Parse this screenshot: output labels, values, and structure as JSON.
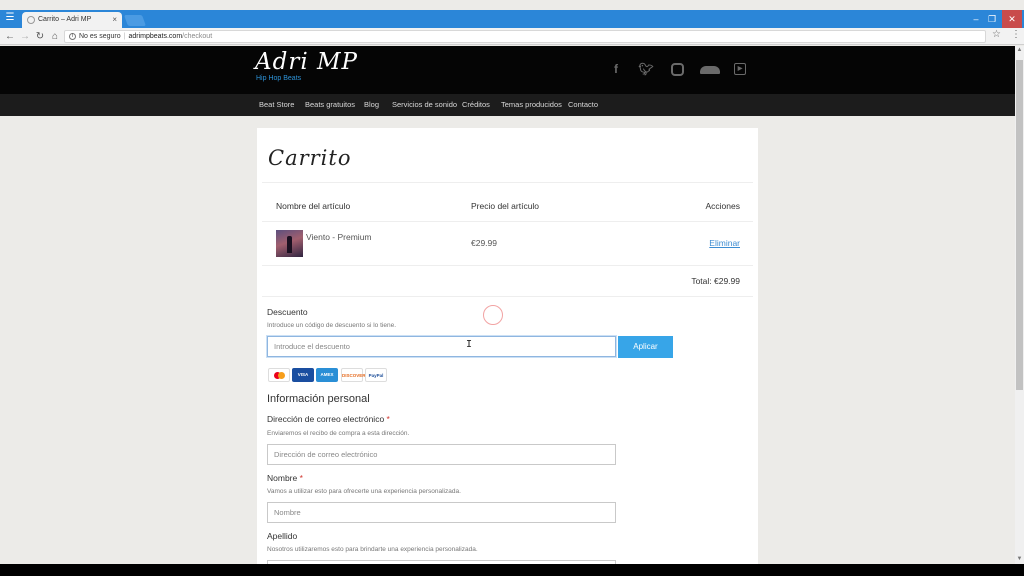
{
  "browser": {
    "tab_title": "Carrito – Adri MP",
    "tab_close": "×",
    "url_security": "No es seguro",
    "url_host": "adrimpbeats.com",
    "url_path": "/checkout"
  },
  "site": {
    "logo": "Adri MP",
    "tagline": "Hip Hop Beats",
    "social": [
      "facebook-icon",
      "twitter-icon",
      "instagram-icon",
      "soundcloud-icon",
      "youtube-icon"
    ],
    "nav": [
      {
        "label": "Beat Store"
      },
      {
        "label": "Beats gratuitos"
      },
      {
        "label": "Blog"
      },
      {
        "label": "Servicios de sonido"
      },
      {
        "label": "Créditos"
      },
      {
        "label": "Temas producidos"
      },
      {
        "label": "Contacto"
      }
    ]
  },
  "cart": {
    "title": "Carrito",
    "columns": {
      "item": "Nombre del artículo",
      "price": "Precio del artículo",
      "actions": "Acciones"
    },
    "items": [
      {
        "name": "Viento - Premium",
        "price": "€29.99",
        "action": "Eliminar"
      }
    ],
    "total": "Total: €29.99"
  },
  "discount": {
    "label": "Descuento",
    "help": "Introduce un código de descuento si lo tiene.",
    "placeholder": "Introduce el descuento",
    "button": "Aplicar"
  },
  "payment_methods": [
    "mastercard",
    "VISA",
    "AMEX",
    "DISCOVER",
    "PayPal"
  ],
  "personal": {
    "title": "Información personal",
    "email_label": "Dirección de correo electrónico",
    "email_required": "*",
    "email_help": "Enviaremos el recibo de compra a esta dirección.",
    "email_placeholder": "Dirección de correo electrónico",
    "name_label": "Nombre",
    "name_required": "*",
    "name_help": "Vamos a utilizar esto para ofrecerte una experiencia personalizada.",
    "name_placeholder": "Nombre",
    "surname_label": "Apellido",
    "surname_help": "Nosotros utilizaremos esto para brindarte una experiencia personalizada."
  },
  "colors": {
    "accent": "#37a5e8",
    "link": "#3d8dd2",
    "required": "#d0342c",
    "header_bg": "#050505",
    "nav_bg": "#1c1c1c"
  }
}
